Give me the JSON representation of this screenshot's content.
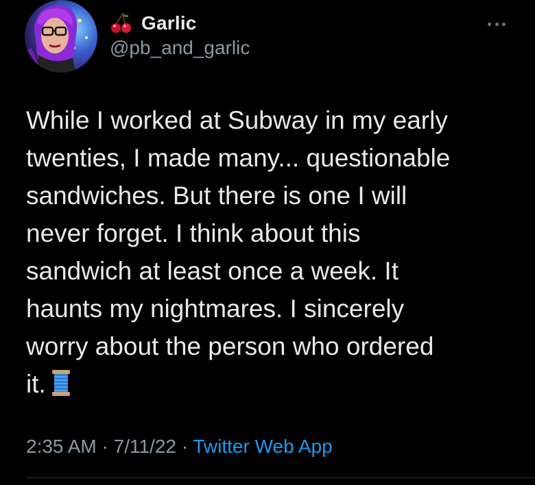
{
  "author": {
    "display_name": "Garlic",
    "handle": "@pb_and_garlic",
    "name_emoji": "cherries-icon"
  },
  "tweet": {
    "lines": [
      "While I worked at Subway in my early",
      "twenties, I made many... questionable",
      "sandwiches. But there is one I will",
      "never forget. I think about this",
      "sandwich at least once a week. It",
      "haunts my nightmares. I sincerely",
      "worry about the person who ordered",
      "it."
    ],
    "trailing_emoji": "thread-spool-icon"
  },
  "meta": {
    "time": "2:35 AM",
    "sep1": " · ",
    "date": "7/11/22",
    "sep2": " · ",
    "source": "Twitter Web App"
  },
  "colors": {
    "background": "#000000",
    "text": "#e7e9ea",
    "secondary": "#8b98a5",
    "link": "#1d9bf0"
  }
}
